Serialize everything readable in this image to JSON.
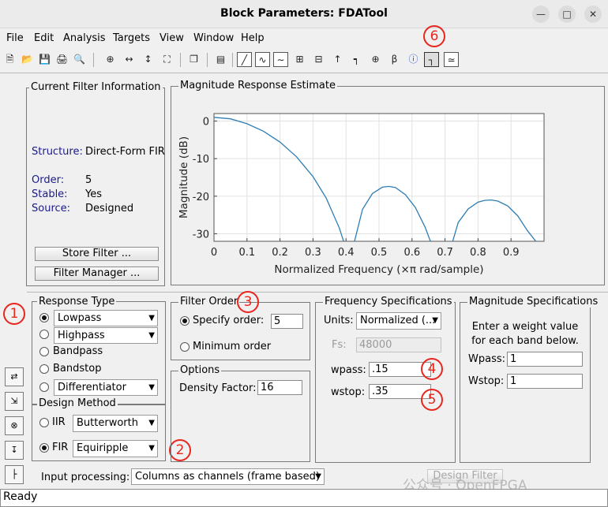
{
  "window": {
    "title": "Block Parameters: FDATool"
  },
  "menu": [
    "File",
    "Edit",
    "Analysis",
    "Targets",
    "View",
    "Window",
    "Help"
  ],
  "current_filter": {
    "legend": "Current Filter Information",
    "structure_label": "Structure:",
    "structure_value": "Direct-Form FIR",
    "order_label": "Order:",
    "order_value": "5",
    "stable_label": "Stable:",
    "stable_value": "Yes",
    "source_label": "Source:",
    "source_value": "Designed",
    "store_button": "Store Filter ...",
    "manager_button": "Filter Manager ..."
  },
  "magnitude_plot": {
    "legend": "Magnitude Response Estimate"
  },
  "chart_data": {
    "type": "line",
    "xlabel": "Normalized Frequency (×π rad/sample)",
    "ylabel": "Magnitude (dB)",
    "xlim": [
      0,
      1
    ],
    "ylim": [
      -32,
      2
    ],
    "xticks": [
      "0",
      "0.1",
      "0.2",
      "0.3",
      "0.4",
      "0.5",
      "0.6",
      "0.7",
      "0.8",
      "0.9"
    ],
    "yticks": [
      "0",
      "-10",
      "-20",
      "-30"
    ],
    "grid": true,
    "series": [
      {
        "x": [
          0,
          0.05,
          0.1,
          0.15,
          0.2,
          0.25,
          0.3,
          0.34,
          0.38,
          0.4
        ],
        "y": [
          1,
          0.6,
          -0.7,
          -2.7,
          -5.6,
          -9.5,
          -14.8,
          -20.5,
          -28.5,
          -34
        ]
      },
      {
        "x": [
          0.42,
          0.45,
          0.48,
          0.51,
          0.53,
          0.55,
          0.58,
          0.61,
          0.64,
          0.66,
          0.68
        ],
        "y": [
          -34,
          -23.5,
          -19.3,
          -17.6,
          -17.4,
          -17.7,
          -19.6,
          -23,
          -28.3,
          -33,
          -36
        ]
      },
      {
        "x": [
          0.71,
          0.74,
          0.77,
          0.8,
          0.82,
          0.84,
          0.86,
          0.89,
          0.92,
          0.95,
          0.975
        ],
        "y": [
          -36,
          -27,
          -23.4,
          -21.6,
          -21.1,
          -21.0,
          -21.3,
          -22.6,
          -25.2,
          -29.2,
          -32
        ]
      }
    ],
    "color": "#2e7db3"
  },
  "response_type": {
    "legend": "Response Type",
    "lowpass": "Lowpass",
    "highpass": "Highpass",
    "bandpass": "Bandpass",
    "bandstop": "Bandstop",
    "differentiator": "Differentiator"
  },
  "design_method": {
    "legend": "Design Method",
    "iir_label": "IIR",
    "iir_select": "Butterworth",
    "fir_label": "FIR",
    "fir_select": "Equiripple"
  },
  "filter_order": {
    "legend": "Filter Order",
    "specify_label": "Specify order:",
    "specify_value": "5",
    "minimum_label": "Minimum order"
  },
  "options": {
    "legend": "Options",
    "density_label": "Density Factor:",
    "density_value": "16"
  },
  "frequency_specs": {
    "legend": "Frequency Specifications",
    "units_label": "Units:",
    "units_value": "Normalized (...",
    "fs_label": "Fs:",
    "fs_value": "48000",
    "wpass_label": "wpass:",
    "wpass_value": ".15",
    "wstop_label": "wstop:",
    "wstop_value": ".35"
  },
  "magnitude_specs": {
    "legend": "Magnitude Specifications",
    "instruction_line1": "Enter a weight value",
    "instruction_line2": "for each band below.",
    "wpass_label": "Wpass:",
    "wpass_value": "1",
    "wstop_label": "Wstop:",
    "wstop_value": "1"
  },
  "input_processing": {
    "label": "Input processing:",
    "value": "Columns as channels (frame based)"
  },
  "design_button": "Design Filter",
  "status": "Ready",
  "watermark": "公众号 · OpenFPGA",
  "callouts": [
    "1",
    "2",
    "3",
    "4",
    "5",
    "6"
  ]
}
